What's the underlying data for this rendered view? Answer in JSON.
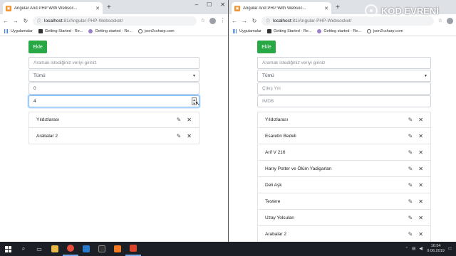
{
  "browser": {
    "tab_title": "Angular And PHP With Websoc...",
    "tab_title_right": "Angular And PHP With Websoc...",
    "url_host": "localhost",
    "url_path": ":81/Angular-PHP-Websocket/",
    "bookmarks": [
      {
        "label": "Uygulamalar",
        "icon": "apps-grid-icon"
      },
      {
        "label": "Getting Started - Re...",
        "icon": "dark-square-icon"
      },
      {
        "label": "Getting started - Re...",
        "icon": "circle-icon"
      },
      {
        "label": "json2csharp.com",
        "icon": "globe-icon"
      }
    ]
  },
  "left_app": {
    "add_button": "Ekle",
    "search_placeholder": "Aramak istediğiniz veriyi giriniz",
    "filter_selected": "Tümü",
    "year_value": "0",
    "imdb_value": "4",
    "items": [
      "Yıldızlarası",
      "Arabalar 2"
    ]
  },
  "right_app": {
    "add_button": "Ekle",
    "search_placeholder": "Aramak istediğiniz veriyi giriniz",
    "filter_selected": "Tümü",
    "year_placeholder": "Çıkış Yılı",
    "imdb_placeholder": "IMDB",
    "items": [
      "Yıldızlarası",
      "Esaretin Bedeli",
      "Arif V 216",
      "Harry Potter ve Ölüm Yadigarları",
      "Deli Aşk",
      "Testere",
      "Uzay Yolcuları",
      "Arabalar 2"
    ]
  },
  "taskbar": {
    "time": "16:54",
    "date": "9.06.2019"
  },
  "watermark": "KOD EVRENİ"
}
